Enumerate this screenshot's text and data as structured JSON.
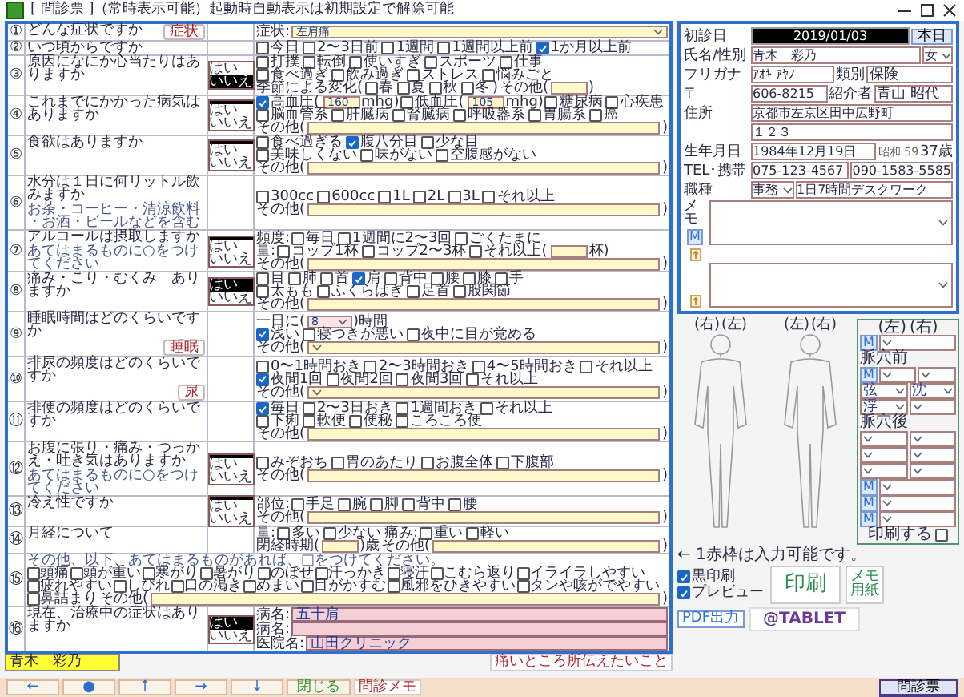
{
  "window": {
    "title": "[ 問診票 ]（常時表示可能）起動時自動表示は初期設定で解除可能"
  },
  "questions": [
    {
      "number": "①",
      "text": "どんな症状ですか",
      "button": "症状",
      "answers": [
        [
          {
            "kind": "label",
            "text": "症状:"
          },
          {
            "kind": "select",
            "value": "左肩痛"
          }
        ]
      ]
    },
    {
      "number": "②",
      "text": "いつ頃からですか",
      "answers": [
        [
          {
            "kind": "check",
            "text": "今日",
            "checked": false
          },
          {
            "kind": "check",
            "text": "2〜3日前",
            "checked": false
          },
          {
            "kind": "check",
            "text": "1週間",
            "checked": false
          },
          {
            "kind": "check",
            "text": "1週間以上前",
            "checked": false
          },
          {
            "kind": "check",
            "text": "1か月以上前",
            "checked": true
          }
        ]
      ]
    },
    {
      "number": "③",
      "text": "原因になにか心当たりはありますか",
      "yesno": [
        {
          "label": "はい",
          "selected": false
        },
        {
          "label": "いいえ",
          "selected": true
        }
      ],
      "answers": [
        [
          {
            "kind": "check",
            "text": "打撲",
            "checked": false
          },
          {
            "kind": "check",
            "text": "転倒",
            "checked": false
          },
          {
            "kind": "check",
            "text": "使いすぎ",
            "checked": false
          },
          {
            "kind": "check",
            "text": "スポーツ",
            "checked": false
          },
          {
            "kind": "check",
            "text": "仕事",
            "checked": false
          }
        ],
        [
          {
            "kind": "check",
            "text": "食べ過ぎ",
            "checked": false
          },
          {
            "kind": "check",
            "text": "飲み過ぎ",
            "checked": false
          },
          {
            "kind": "check",
            "text": "ストレス",
            "checked": false
          },
          {
            "kind": "check",
            "text": "悩みごと",
            "checked": false
          }
        ],
        [
          {
            "kind": "label",
            "text": "季節による変化("
          },
          {
            "kind": "check",
            "text": "春",
            "checked": false
          },
          {
            "kind": "check",
            "text": "夏",
            "checked": false
          },
          {
            "kind": "check",
            "text": "秋",
            "checked": false
          },
          {
            "kind": "check",
            "text": "冬",
            "checked": false
          },
          {
            "kind": "label",
            "text": ")"
          },
          {
            "kind": "label",
            "text": "その他("
          },
          {
            "kind": "short"
          },
          {
            "kind": "label",
            "text": ")"
          }
        ]
      ]
    },
    {
      "number": "④",
      "text": "これまでにかかった病気はありますか",
      "yesno": [
        {
          "label": "はい",
          "selected": false
        },
        {
          "label": "いいえ",
          "selected": false
        }
      ],
      "answers": [
        [
          {
            "kind": "check",
            "text": "高血圧(",
            "checked": true
          },
          {
            "kind": "short",
            "value": "160"
          },
          {
            "kind": "label",
            "text": "mhg)"
          },
          {
            "kind": "check",
            "text": "低血圧(",
            "checked": false
          },
          {
            "kind": "short",
            "value": "105"
          },
          {
            "kind": "label",
            "text": "mhg)"
          },
          {
            "kind": "check",
            "text": "糖尿病",
            "checked": false
          },
          {
            "kind": "check",
            "text": "心疾患",
            "checked": false
          }
        ],
        [
          {
            "kind": "check",
            "text": "脳血管系",
            "checked": false
          },
          {
            "kind": "check",
            "text": "肝臓病",
            "checked": false
          },
          {
            "kind": "check",
            "text": "腎臓病",
            "checked": false
          },
          {
            "kind": "check",
            "text": "呼吸器系",
            "checked": false
          },
          {
            "kind": "check",
            "text": "胃腸系",
            "checked": false
          },
          {
            "kind": "check",
            "text": "癌",
            "checked": false
          }
        ],
        [
          {
            "kind": "label",
            "text": "その他("
          },
          {
            "kind": "field"
          },
          {
            "kind": "label",
            "text": ")"
          }
        ]
      ]
    },
    {
      "number": "⑤",
      "text": "食欲はありますか",
      "yesno": [
        {
          "label": "はい",
          "selected": false
        },
        {
          "label": "いいえ",
          "selected": false
        }
      ],
      "answers": [
        [
          {
            "kind": "check",
            "text": "食べ過ぎる",
            "checked": false
          },
          {
            "kind": "check",
            "text": "腹八分目",
            "checked": true
          },
          {
            "kind": "check",
            "text": "少な目",
            "checked": false
          }
        ],
        [
          {
            "kind": "check",
            "text": "美味しくない",
            "checked": false
          },
          {
            "kind": "check",
            "text": "味がない",
            "checked": false
          },
          {
            "kind": "check",
            "text": "空腹感がない",
            "checked": false
          }
        ],
        [
          {
            "kind": "label",
            "text": "その他("
          },
          {
            "kind": "field"
          },
          {
            "kind": "label",
            "text": ")"
          }
        ]
      ]
    },
    {
      "number": "⑥",
      "text": "水分は１日に何リットル飲みますか",
      "note": "お茶・コーヒー・清涼飲料・お酒・ビールなどを含む",
      "answers": [
        [
          {
            "kind": "check",
            "text": "300cc",
            "checked": false
          },
          {
            "kind": "check",
            "text": "600cc",
            "checked": false
          },
          {
            "kind": "check",
            "text": "1L",
            "checked": false
          },
          {
            "kind": "check",
            "text": "2L",
            "checked": false
          },
          {
            "kind": "check",
            "text": "3L",
            "checked": false
          },
          {
            "kind": "check",
            "text": "それ以上",
            "checked": false
          }
        ],
        [
          {
            "kind": "label",
            "text": "その他("
          },
          {
            "kind": "field"
          },
          {
            "kind": "label",
            "text": ")"
          }
        ]
      ]
    },
    {
      "number": "⑦",
      "text": "アルコールは摂取しますか",
      "note": "あてはまるものに○をつけてください",
      "yesno": [
        {
          "label": "はい",
          "selected": false
        },
        {
          "label": "いいえ",
          "selected": false
        }
      ],
      "answers": [
        [
          {
            "kind": "label",
            "text": "頻度:"
          },
          {
            "kind": "check",
            "text": "毎日",
            "checked": false
          },
          {
            "kind": "check",
            "text": "1週間に2〜3回",
            "checked": false
          },
          {
            "kind": "check",
            "text": "ごくたまに",
            "checked": false
          }
        ],
        [
          {
            "kind": "label",
            "text": "量:"
          },
          {
            "kind": "check",
            "text": "コップ1杯",
            "checked": false
          },
          {
            "kind": "check",
            "text": "コップ2〜3杯",
            "checked": false
          },
          {
            "kind": "check",
            "text": "それ以上(",
            "checked": false
          },
          {
            "kind": "short"
          },
          {
            "kind": "label",
            "text": "杯)"
          }
        ],
        [
          {
            "kind": "label",
            "text": "その他("
          },
          {
            "kind": "field"
          },
          {
            "kind": "label",
            "text": ")"
          }
        ]
      ]
    },
    {
      "number": "⑧",
      "text": "痛み・こり・むくみ　ありますか",
      "yesno": [
        {
          "label": "はい",
          "selected": true
        },
        {
          "label": "いいえ",
          "selected": false
        }
      ],
      "answers": [
        [
          {
            "kind": "check",
            "text": "目",
            "checked": false
          },
          {
            "kind": "check",
            "text": "肺",
            "checked": false
          },
          {
            "kind": "check",
            "text": "首",
            "checked": false
          },
          {
            "kind": "check",
            "text": "肩",
            "checked": true
          },
          {
            "kind": "check",
            "text": "背中",
            "checked": false
          },
          {
            "kind": "check",
            "text": "腰",
            "checked": false
          },
          {
            "kind": "check",
            "text": "膝",
            "checked": false
          },
          {
            "kind": "check",
            "text": "手",
            "checked": false
          }
        ],
        [
          {
            "kind": "check",
            "text": "太もも",
            "checked": false
          },
          {
            "kind": "check",
            "text": "ふくらはぎ",
            "checked": false
          },
          {
            "kind": "check",
            "text": "足首",
            "checked": false
          },
          {
            "kind": "check",
            "text": "股関節",
            "checked": false
          }
        ],
        [
          {
            "kind": "label",
            "text": "その他("
          },
          {
            "kind": "field"
          },
          {
            "kind": "label",
            "text": ")"
          }
        ]
      ]
    },
    {
      "number": "⑨",
      "text": "睡眠時間はどのくらいですか",
      "button": "睡眠",
      "answers": [
        [
          {
            "kind": "label",
            "text": "一日に("
          },
          {
            "kind": "smallselect",
            "value": "8"
          },
          {
            "kind": "label",
            "text": ")時間"
          }
        ],
        [
          {
            "kind": "check",
            "text": "浅い",
            "checked": true
          },
          {
            "kind": "check",
            "text": "寝つきが悪い",
            "checked": false
          },
          {
            "kind": "check",
            "text": "夜中に目が覚める",
            "checked": false
          }
        ],
        [
          {
            "kind": "label",
            "text": "その他("
          },
          {
            "kind": "select"
          },
          {
            "kind": "label",
            "text": ")"
          }
        ]
      ]
    },
    {
      "number": "⑩",
      "text": "排尿の頻度はどのくらいですか",
      "button": "尿",
      "answers": [
        [
          {
            "kind": "check",
            "text": "0〜1時間おき",
            "checked": false
          },
          {
            "kind": "check",
            "text": "2〜3時間おき",
            "checked": false
          },
          {
            "kind": "check",
            "text": "4〜5時間おき",
            "checked": false
          },
          {
            "kind": "check",
            "text": "それ以上",
            "checked": false
          }
        ],
        [
          {
            "kind": "check",
            "text": "夜間1回",
            "checked": true
          },
          {
            "kind": "check",
            "text": "夜間2回",
            "checked": false
          },
          {
            "kind": "check",
            "text": "夜間3回",
            "checked": false
          },
          {
            "kind": "check",
            "text": "それ以上",
            "checked": false
          }
        ],
        [
          {
            "kind": "label",
            "text": "その他("
          },
          {
            "kind": "select"
          },
          {
            "kind": "label",
            "text": ")"
          }
        ]
      ]
    },
    {
      "number": "⑪",
      "text": "排便の頻度はどのくらいですか",
      "answers": [
        [
          {
            "kind": "check",
            "text": "毎日",
            "checked": true
          },
          {
            "kind": "check",
            "text": "2〜3日おき",
            "checked": false
          },
          {
            "kind": "check",
            "text": "1週間おき",
            "checked": false
          },
          {
            "kind": "check",
            "text": "それ以上",
            "checked": false
          }
        ],
        [
          {
            "kind": "check",
            "text": "下痢",
            "checked": false
          },
          {
            "kind": "check",
            "text": "軟便",
            "checked": false
          },
          {
            "kind": "check",
            "text": "便秘",
            "checked": false
          },
          {
            "kind": "check",
            "text": "ころころ便",
            "checked": false
          }
        ],
        [
          {
            "kind": "label",
            "text": "その他("
          },
          {
            "kind": "field"
          },
          {
            "kind": "label",
            "text": ")"
          }
        ]
      ]
    },
    {
      "number": "⑫",
      "text": "お腹に張り・痛み・つっかえ・吐き気はありますか",
      "note": "あてはまるものに○をつけてください",
      "yesno": [
        {
          "label": "はい",
          "selected": false
        },
        {
          "label": "いいえ",
          "selected": false
        }
      ],
      "answers": [
        [
          {
            "kind": "check",
            "text": "みぞおち",
            "checked": false
          },
          {
            "kind": "check",
            "text": "胃のあたり",
            "checked": false
          },
          {
            "kind": "check",
            "text": "お腹全体",
            "checked": false
          },
          {
            "kind": "check",
            "text": "下腹部",
            "checked": false
          }
        ],
        [
          {
            "kind": "label",
            "text": "その他("
          },
          {
            "kind": "field"
          },
          {
            "kind": "label",
            "text": ")"
          }
        ]
      ]
    },
    {
      "number": "⑬",
      "text": "冷え性ですか",
      "yesno": [
        {
          "label": "はい",
          "selected": false
        },
        {
          "label": "いいえ",
          "selected": false
        }
      ],
      "answers": [
        [
          {
            "kind": "label",
            "text": "部位:"
          },
          {
            "kind": "check",
            "text": "手足",
            "checked": false
          },
          {
            "kind": "check",
            "text": "腕",
            "checked": false
          },
          {
            "kind": "check",
            "text": "脚",
            "checked": false
          },
          {
            "kind": "check",
            "text": "背中",
            "checked": false
          },
          {
            "kind": "check",
            "text": "腰",
            "checked": false
          }
        ],
        [
          {
            "kind": "label",
            "text": "その他("
          },
          {
            "kind": "field"
          },
          {
            "kind": "label",
            "text": ")"
          }
        ]
      ]
    },
    {
      "number": "⑭",
      "text": "月経について",
      "answers": [
        [
          {
            "kind": "label",
            "text": "量:"
          },
          {
            "kind": "check",
            "text": "多い",
            "checked": false
          },
          {
            "kind": "check",
            "text": "少ない",
            "checked": false
          },
          {
            "kind": "label",
            "text": "痛み:"
          },
          {
            "kind": "check",
            "text": "重い",
            "checked": false
          },
          {
            "kind": "check",
            "text": "軽い",
            "checked": false
          }
        ],
        [
          {
            "kind": "label",
            "text": "閉経時期("
          },
          {
            "kind": "short"
          },
          {
            "kind": "label",
            "text": ")歳"
          },
          {
            "kind": "label",
            "text": "その他("
          },
          {
            "kind": "field"
          },
          {
            "kind": "label",
            "text": ")"
          }
        ]
      ]
    },
    {
      "number": "⑮",
      "kind": "wide",
      "note": "その他、以下、あてはまるものがあれば、□をつけてください。",
      "answers": [
        [
          {
            "kind": "check",
            "text": "頭痛",
            "checked": false
          },
          {
            "kind": "check",
            "text": "頭が重い",
            "checked": false
          },
          {
            "kind": "check",
            "text": "寒がり",
            "checked": false
          },
          {
            "kind": "check",
            "text": "暑がり",
            "checked": false
          },
          {
            "kind": "check",
            "text": "のぼせ",
            "checked": false
          },
          {
            "kind": "check",
            "text": "汗っかき",
            "checked": false
          },
          {
            "kind": "check",
            "text": "寝汗",
            "checked": false
          },
          {
            "kind": "check",
            "text": "こむら返り",
            "checked": false
          },
          {
            "kind": "check",
            "text": "イライラしやすい",
            "checked": false
          }
        ],
        [
          {
            "kind": "check",
            "text": "疲れやすい",
            "checked": false
          },
          {
            "kind": "check",
            "text": "しびれ",
            "checked": false
          },
          {
            "kind": "check",
            "text": "口の渇き",
            "checked": false
          },
          {
            "kind": "check",
            "text": "めまい",
            "checked": false
          },
          {
            "kind": "check",
            "text": "目がかすむ",
            "checked": false
          },
          {
            "kind": "check",
            "text": "風邪をひきやすい",
            "checked": false
          },
          {
            "kind": "check",
            "text": "タンや咳がでやすい",
            "checked": false
          }
        ],
        [
          {
            "kind": "check",
            "text": "鼻詰まり",
            "checked": false
          },
          {
            "kind": "label",
            "text": "その他("
          },
          {
            "kind": "field"
          },
          {
            "kind": "label",
            "text": ")"
          }
        ]
      ]
    },
    {
      "number": "⑯",
      "text": "現在、治療中の症状はありますか",
      "yesno": [
        {
          "label": "はい",
          "selected": true
        },
        {
          "label": "いいえ",
          "selected": false
        }
      ],
      "answers": [
        [
          {
            "kind": "label",
            "text": "病名:"
          },
          {
            "kind": "record",
            "value": "五十肩"
          }
        ],
        [
          {
            "kind": "label",
            "text": "病名:"
          },
          {
            "kind": "record"
          }
        ],
        [
          {
            "kind": "label",
            "text": "医院名:"
          },
          {
            "kind": "record",
            "value": "山田クリニック"
          }
        ]
      ]
    }
  ],
  "footer": {
    "patient_name": "青木　彩乃",
    "link": "痛いところ所伝えたいこと",
    "nav": [
      "←",
      "●",
      "↑",
      "→",
      "↓",
      "閉じる"
    ],
    "memo_button": "問診メモ",
    "form_button": "問診票"
  },
  "patient": [
    {
      "label": "初診日",
      "parts": [
        {
          "kind": "date",
          "value": "2019/01/03"
        },
        {
          "kind": "button",
          "text": "本日"
        }
      ]
    },
    {
      "label": "氏名/性別",
      "parts": [
        {
          "kind": "field",
          "value": "青木　彩乃"
        },
        {
          "kind": "select",
          "value": "女"
        }
      ]
    },
    {
      "label": "フリガナ",
      "parts": [
        {
          "kind": "field",
          "value": "ｱｵｷ ｱﾔﾉ"
        },
        {
          "kind": "label",
          "text": "類別"
        },
        {
          "kind": "small",
          "value": "保険"
        }
      ]
    },
    {
      "label": "〒",
      "parts": [
        {
          "kind": "field",
          "value": "606-8215"
        },
        {
          "kind": "label",
          "text": "紹介者"
        },
        {
          "kind": "small",
          "value": "青山 昭代"
        }
      ]
    },
    {
      "label": "住所",
      "parts": [
        {
          "kind": "field",
          "value": "京都市左京区田中広野町"
        }
      ]
    },
    {
      "parts": [
        {
          "kind": "field",
          "value": "１２３"
        }
      ]
    },
    {
      "label": "生年月日",
      "parts": [
        {
          "kind": "field",
          "value": "1984年12月19日"
        },
        {
          "kind": "note",
          "text": "昭和 59"
        },
        {
          "kind": "label",
          "text": "37歳"
        }
      ]
    },
    {
      "label": "TEL･携帯",
      "parts": [
        {
          "kind": "field",
          "value": "075-123-4567"
        },
        {
          "kind": "field",
          "value": "090-1583-5585"
        }
      ]
    },
    {
      "label": "職種",
      "parts": [
        {
          "kind": "select",
          "value": "事務"
        },
        {
          "kind": "field",
          "value": "1日7時間デスクワーク"
        }
      ]
    }
  ],
  "memo": {
    "label": "メモ",
    "marker": "M"
  },
  "figures": [
    {
      "left": "(右)",
      "right": "(左)"
    },
    {
      "left": "(左)",
      "right": "(右)"
    }
  ],
  "pulse": {
    "header": [
      "(左)",
      "(右)"
    ],
    "rows": [
      {
        "kind": "mselect",
        "marker": "M"
      },
      {
        "kind": "label",
        "text": "脈穴前"
      },
      {
        "kind": "mpair",
        "marker": "M"
      },
      {
        "kind": "pair",
        "left": "弦",
        "right": "沈"
      },
      {
        "kind": "pair",
        "left": "浮"
      },
      {
        "kind": "label",
        "text": "脈穴後"
      },
      {
        "kind": "pair"
      },
      {
        "kind": "pair"
      },
      {
        "kind": "pair"
      },
      {
        "kind": "mselect",
        "marker": "M"
      },
      {
        "kind": "mselect",
        "marker": "M"
      },
      {
        "kind": "mselect",
        "marker": "M"
      }
    ],
    "print_label": "印刷する",
    "print_checked": false
  },
  "print": {
    "note": "← 1赤枠は入力可能です。",
    "options": [
      {
        "label": "黒印刷",
        "checked": true
      },
      {
        "label": "プレビュー",
        "checked": true
      }
    ],
    "print_button": "印刷",
    "memo_paper_button": "メモ用紙",
    "pdf_button": "PDF出力",
    "tablet_button": "@TABLET"
  }
}
